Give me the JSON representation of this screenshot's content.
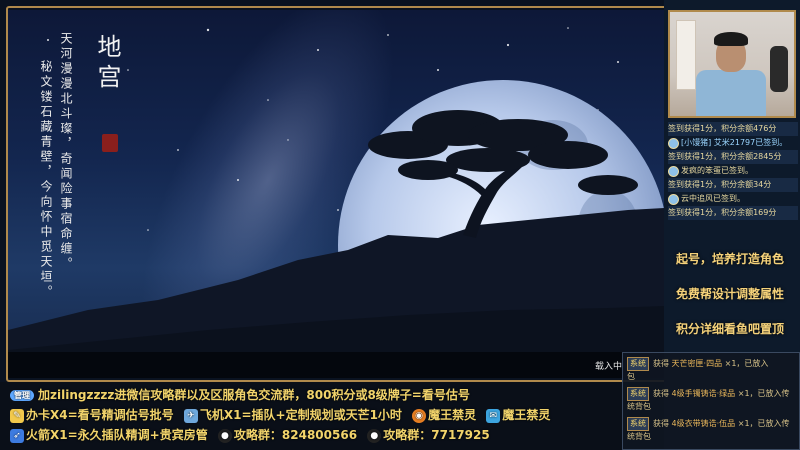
{
  "game": {
    "title": "地宫",
    "poem_col1": "天河漫漫北斗璨",
    "poem_col1b": "，奇闻险事宿命缠。",
    "poem_col2": "秘文镂石藏青壁",
    "poem_col2b": "，今向怀中觅天垣。",
    "loading_text": "载入中"
  },
  "webcam": {
    "description_icon": "streamer-webcam"
  },
  "feed": [
    {
      "text": "签到获得1分，积分余额476分",
      "style": "dark"
    },
    {
      "text": "[小馒猪] 艾米21797已签到。",
      "style": "normal"
    },
    {
      "text": "签到获得1分，积分余额2845分",
      "style": "dark"
    },
    {
      "text": "发疯的笨蛋已签到。",
      "style": "normal"
    },
    {
      "text": "签到获得1分，积分余额34分",
      "style": "dark"
    },
    {
      "text": "云中追风已签到。",
      "style": "normal"
    },
    {
      "text": "签到获得1分，积分余额169分",
      "style": "dark"
    }
  ],
  "ads": [
    "起号，培养打造角色",
    "免费帮设计调整属性",
    "积分详细看鱼吧置顶"
  ],
  "bottom": {
    "line1_badge": "管理",
    "line1": "加zilingzzzz进微信攻略群以及区服角色交流群，800积分或8级牌子=看号估号",
    "line2a": "办卡X4=看号精调估号批号",
    "line2b": "飞机X1=插队+定制规划或天芒1小时",
    "line2c": "魔王禁灵",
    "line2d": "魔王禁灵",
    "line3a": "火箭X1=永久插队精调+贵宾房管",
    "line3b": "攻略群：824800566",
    "line3c": "攻略群：7717925"
  },
  "log": {
    "tag": "系统",
    "rows": [
      {
        "prefix": "获得",
        "item": "天芒密匣·四品",
        "suffix": "×1，已放入",
        "suffix2": "包"
      },
      {
        "prefix": "获得",
        "item": "4级手镯铸诰·绿品",
        "suffix": "×1，已放入传",
        "suffix2": "统背包"
      },
      {
        "prefix": "获得",
        "item": "4级衣带铸诰·伍品",
        "suffix": "×1，已放入传",
        "suffix2": "统背包"
      }
    ]
  },
  "colors": {
    "accent_gold": "#f2d46b",
    "frame_gold": "#b08a4c"
  }
}
